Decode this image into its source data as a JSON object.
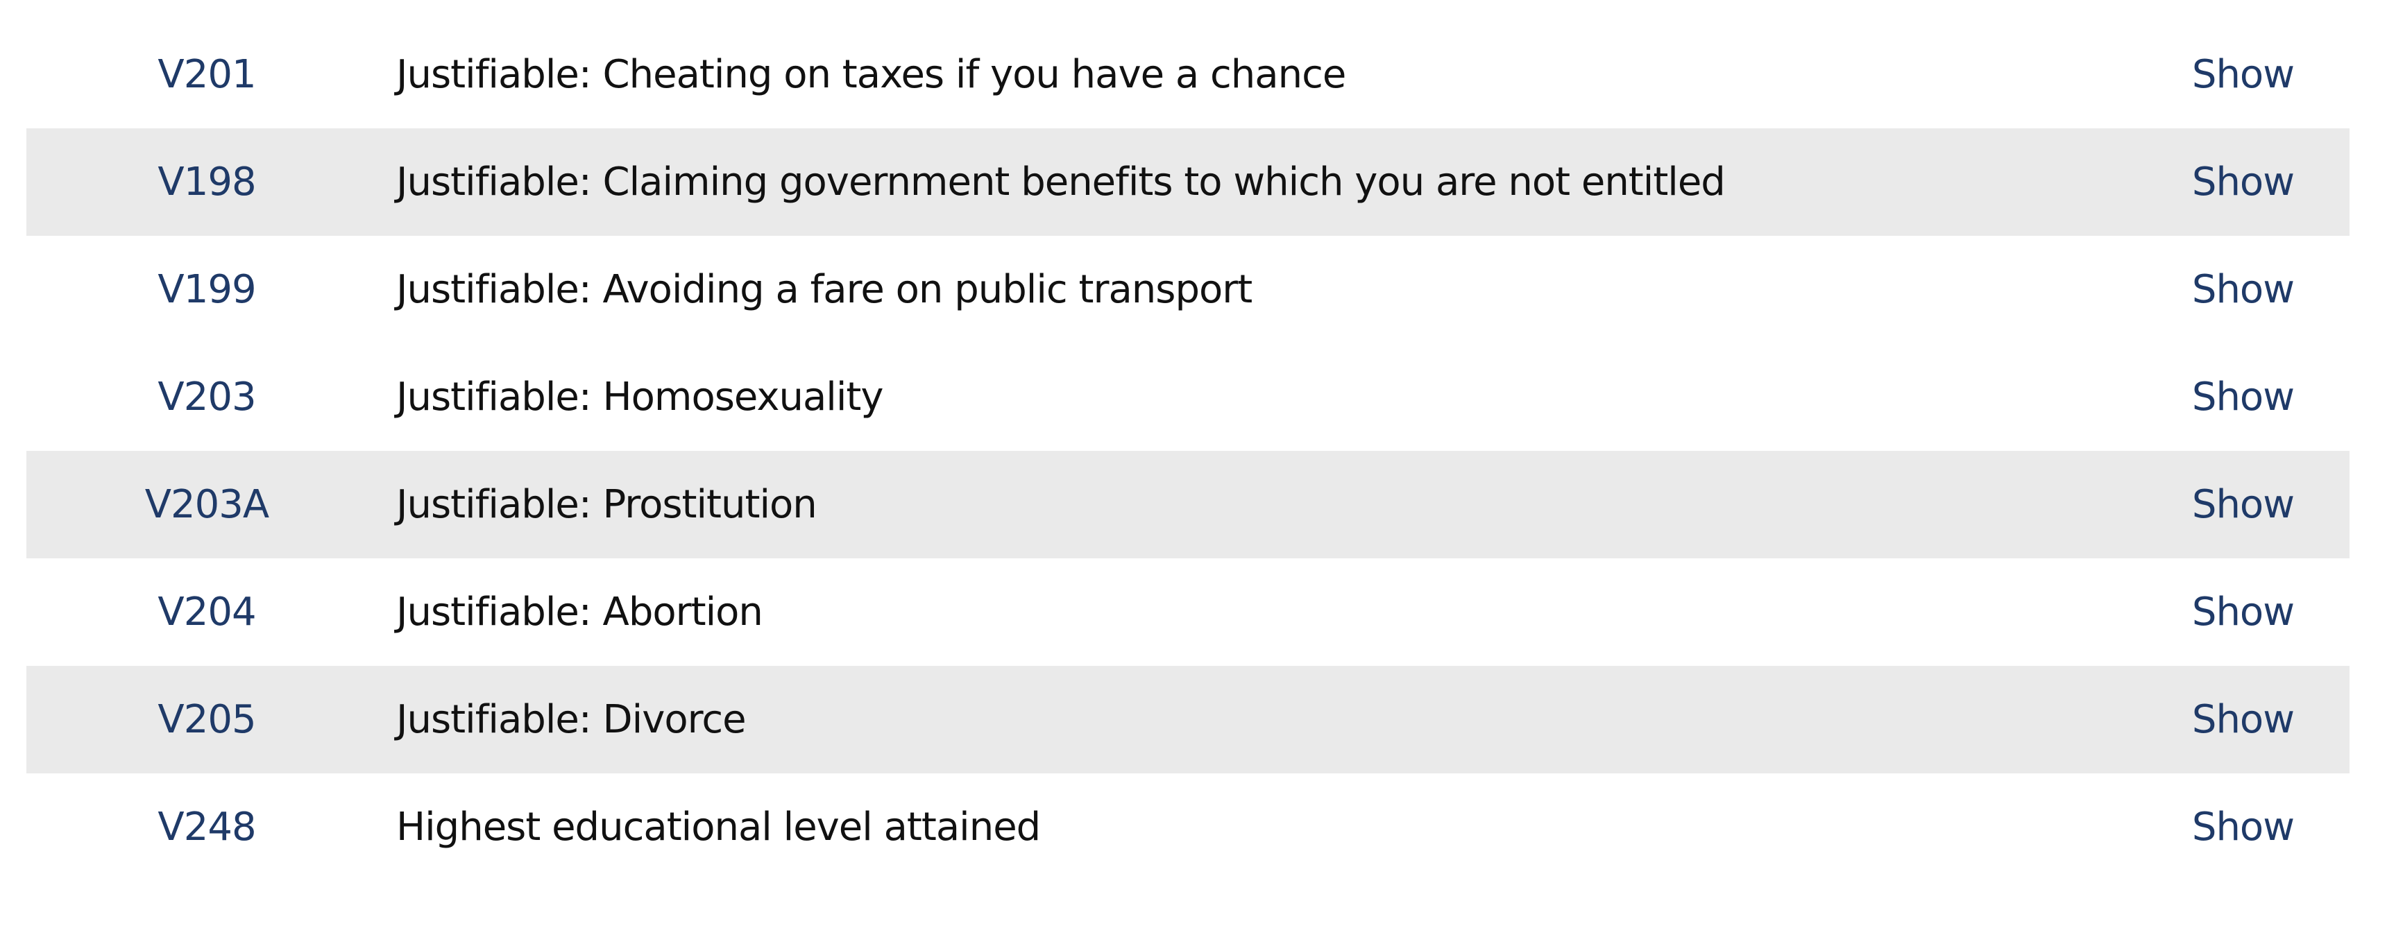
{
  "colors": {
    "link": "#1f3a68",
    "text": "#111111",
    "row_shade": "#eaeaea",
    "background": "#ffffff"
  },
  "rows": [
    {
      "code": "V201",
      "label": "Justifiable: Cheating on taxes if you have a chance",
      "action": "Show"
    },
    {
      "code": "V198",
      "label": "Justifiable: Claiming government benefits to which you are not entitled",
      "action": "Show"
    },
    {
      "code": "V199",
      "label": "Justifiable: Avoiding a fare on public transport",
      "action": "Show"
    },
    {
      "code": "V203",
      "label": "Justifiable: Homosexuality",
      "action": "Show"
    },
    {
      "code": "V203A",
      "label": "Justifiable: Prostitution",
      "action": "Show"
    },
    {
      "code": "V204",
      "label": "Justifiable: Abortion",
      "action": "Show"
    },
    {
      "code": "V205",
      "label": "Justifiable: Divorce",
      "action": "Show"
    },
    {
      "code": "V248",
      "label": "Highest educational level attained",
      "action": "Show"
    }
  ]
}
